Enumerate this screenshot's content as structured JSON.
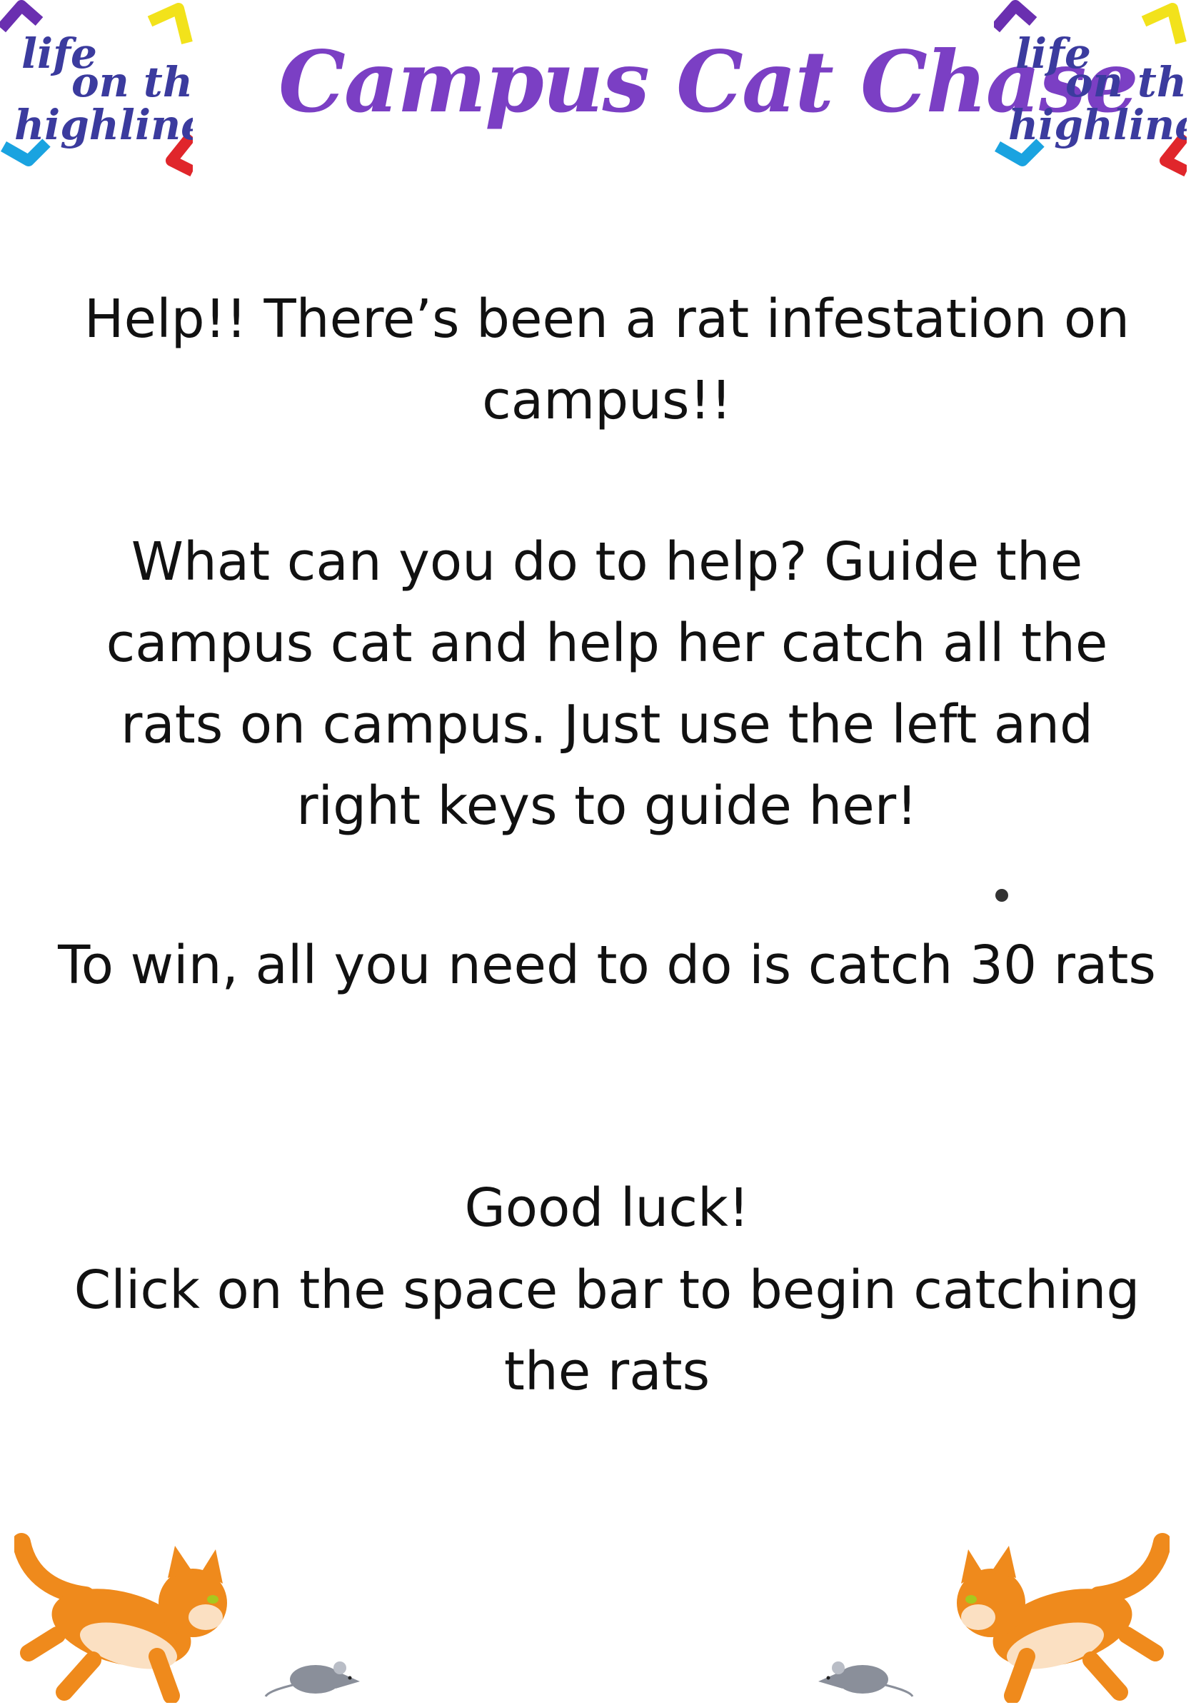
{
  "header": {
    "title": "Campus Cat Chase",
    "logo_text": [
      "life",
      "on the",
      "highline"
    ]
  },
  "instructions": {
    "line1": "Help!! There’s been a rat infestation on campus!!",
    "line2": "What can you do to help? Guide the campus cat and help her catch all the rats on campus. Just use the left and right keys to guide her!",
    "line3": "To win, all you need to do is catch 30 rats",
    "line4": "Good luck!",
    "line5": "Click on the space bar to begin catching the rats"
  },
  "colors": {
    "title": "#7b3fc4",
    "logo_text": "#3b3b9e",
    "logo_purple": "#6a2fb0",
    "logo_yellow": "#f2e21b",
    "logo_blue": "#1aa3e0",
    "logo_red": "#e0262b",
    "cat_orange": "#ef8a1c",
    "cat_cream": "#fbe0c2",
    "rat_grey": "#8a8f9a",
    "text": "#111111"
  },
  "icons": {
    "logo": "life-on-the-highline-logo",
    "cat": "running-cat-icon",
    "rat": "rat-icon"
  }
}
